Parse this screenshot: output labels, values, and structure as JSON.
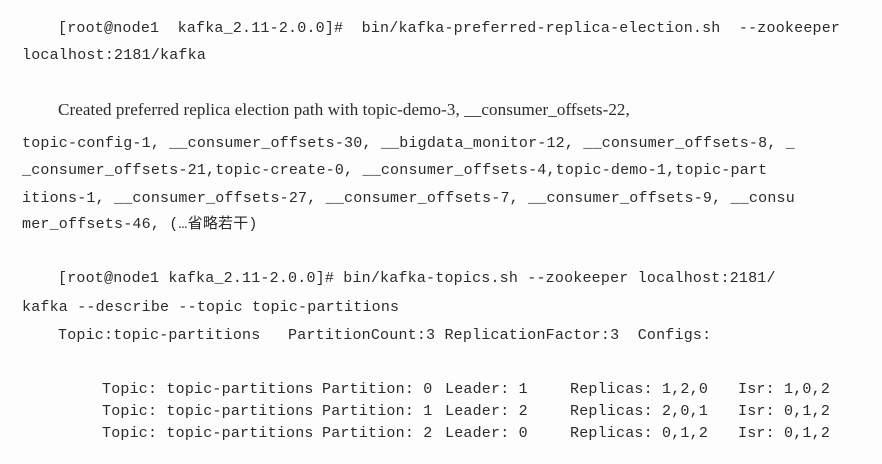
{
  "command1": {
    "line1": "[root@node1  kafka_2.11-2.0.0]#  bin/kafka-preferred-replica-election.sh  --zookeeper",
    "line2": "localhost:2181/kafka"
  },
  "output1": {
    "line1": "Created preferred replica election path with topic-demo-3, __consumer_offsets-22,",
    "line2": "topic-config-1, __consumer_offsets-30, __bigdata_monitor-12, __consumer_offsets-8, _",
    "line3": "_consumer_offsets-21,topic-create-0, __consumer_offsets-4,topic-demo-1,topic-part",
    "line4": "itions-1, __consumer_offsets-27, __consumer_offsets-7, __consumer_offsets-9, __consu",
    "line5": "mer_offsets-46, (…省略若干)"
  },
  "command2": {
    "line1": "[root@node1 kafka_2.11-2.0.0]# bin/kafka-topics.sh --zookeeper localhost:2181/",
    "line2": "kafka --describe --topic topic-partitions"
  },
  "describe": {
    "summary": "Topic:topic-partitions   PartitionCount:3 ReplicationFactor:3  Configs:",
    "rows": [
      {
        "topic": "Topic: topic-partitions",
        "partition": "Partition: 0",
        "leader": "Leader: 1",
        "replicas": "Replicas: 1,2,0",
        "isr": "Isr: 1,0,2"
      },
      {
        "topic": "Topic: topic-partitions",
        "partition": "Partition: 1",
        "leader": "Leader: 2",
        "replicas": "Replicas: 2,0,1",
        "isr": "Isr: 0,1,2"
      },
      {
        "topic": "Topic: topic-partitions",
        "partition": "Partition: 2",
        "leader": "Leader: 0",
        "replicas": "Replicas: 0,1,2",
        "isr": "Isr: 0,1,2"
      }
    ]
  }
}
